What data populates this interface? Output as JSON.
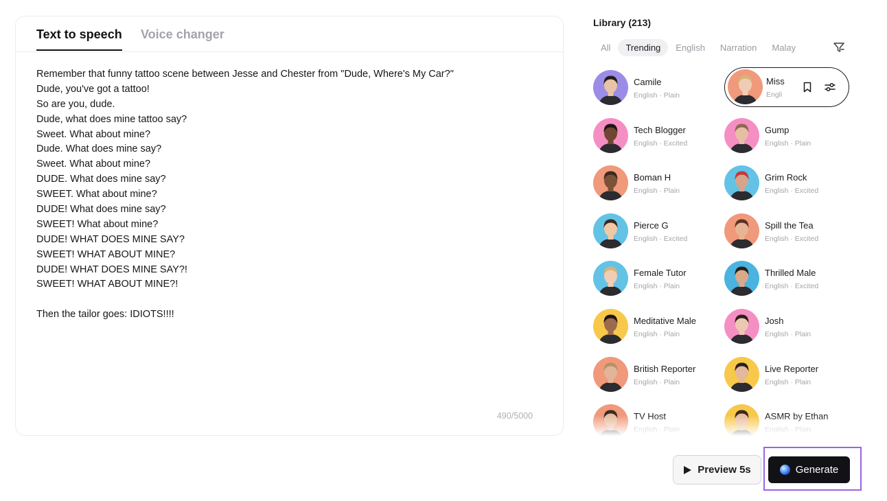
{
  "editor": {
    "tabs": [
      {
        "label": "Text to speech",
        "active": true
      },
      {
        "label": "Voice changer",
        "active": false
      }
    ],
    "lines": [
      "Remember that funny tattoo scene between Jesse and Chester from \"Dude, Where's My Car?\"",
      "Dude, you've got a tattoo!",
      "So are you, dude.",
      "Dude, what does mine tattoo say?",
      "Sweet. What about mine?",
      "Dude. What does mine say?",
      "Sweet. What about mine?",
      "DUDE. What does mine say?",
      "SWEET. What about mine?",
      "DUDE! What does mine say?",
      "SWEET! What about mine?",
      "DUDE! WHAT DOES MINE SAY?",
      "SWEET! WHAT ABOUT MINE?",
      "DUDE! WHAT DOES MINE SAY?!",
      "SWEET! WHAT ABOUT MINE?!",
      "",
      "Then the tailor goes: IDIOTS!!!!"
    ],
    "char_count": "490/5000"
  },
  "library": {
    "title": "Library (213)",
    "filters": [
      {
        "label": "All",
        "active": false
      },
      {
        "label": "Trending",
        "active": true
      },
      {
        "label": "English",
        "active": false
      },
      {
        "label": "Narration",
        "active": false
      },
      {
        "label": "Malay",
        "active": false
      }
    ],
    "filter_icon": "filter-funnel-icon",
    "voices": [
      {
        "name": "Camile",
        "meta": "English · Plain",
        "color": "#9b8ce8",
        "skin": "#e9c3a8",
        "hair": "#241c18"
      },
      {
        "name": "Miss",
        "meta": "Engli",
        "color": "#f0997b",
        "skin": "#efcdb5",
        "hair": "#d9b27a",
        "selected": true
      },
      {
        "name": "Tech Blogger",
        "meta": "English · Excited",
        "color": "#f58fc3",
        "skin": "#6e4631",
        "hair": "#1e1612"
      },
      {
        "name": "Gump",
        "meta": "English · Plain",
        "color": "#f58fc3",
        "skin": "#e6bea6",
        "hair": "#8d6a4c"
      },
      {
        "name": "Boman H",
        "meta": "English · Plain",
        "color": "#f0997b",
        "skin": "#7a5238",
        "hair": "#3d2a1e"
      },
      {
        "name": "Grim Rock",
        "meta": "English · Excited",
        "color": "#63c3e6",
        "skin": "#d4a58c",
        "hair": "#c33a3a"
      },
      {
        "name": "Pierce G",
        "meta": "English · Excited",
        "color": "#63c3e6",
        "skin": "#f0c9a4",
        "hair": "#3a2a22"
      },
      {
        "name": "Spill the Tea",
        "meta": "English · Excited",
        "color": "#f0997b",
        "skin": "#e7b596",
        "hair": "#5b3323"
      },
      {
        "name": "Female Tutor",
        "meta": "English · Plain",
        "color": "#63c3e6",
        "skin": "#f0cdb4",
        "hair": "#d8b27c"
      },
      {
        "name": "Thrilled Male",
        "meta": "English · Excited",
        "color": "#4ab3e0",
        "skin": "#d9a989",
        "hair": "#2a1e18"
      },
      {
        "name": "Meditative Male",
        "meta": "English · Plain",
        "color": "#f7c84a",
        "skin": "#9c6a4c",
        "hair": "#1b1410"
      },
      {
        "name": "Josh",
        "meta": "English · Plain",
        "color": "#f58fc3",
        "skin": "#ecc8b2",
        "hair": "#2a1f19"
      },
      {
        "name": "British Reporter",
        "meta": "English · Plain",
        "color": "#f0997b",
        "skin": "#e3b598",
        "hair": "#b5916a"
      },
      {
        "name": "Live Reporter",
        "meta": "English · Plain",
        "color": "#f7c84a",
        "skin": "#e4b89a",
        "hair": "#2b211b"
      },
      {
        "name": "TV Host",
        "meta": "English · Plain",
        "color": "#f0997b",
        "skin": "#e6bb9d",
        "hair": "#3b2c22"
      },
      {
        "name": "ASMR by Ethan",
        "meta": "English · Plain",
        "color": "#f7c84a",
        "skin": "#e8bd9f",
        "hair": "#3a2a20"
      }
    ],
    "selected_actions": [
      {
        "icon": "bookmark-icon"
      },
      {
        "icon": "sliders-icon"
      }
    ]
  },
  "actions": {
    "preview_label": "Preview 5s",
    "preview_icon": "play-icon",
    "generate_label": "Generate",
    "generate_icon": "orb-icon",
    "highlight_color": "#9d62e6"
  }
}
